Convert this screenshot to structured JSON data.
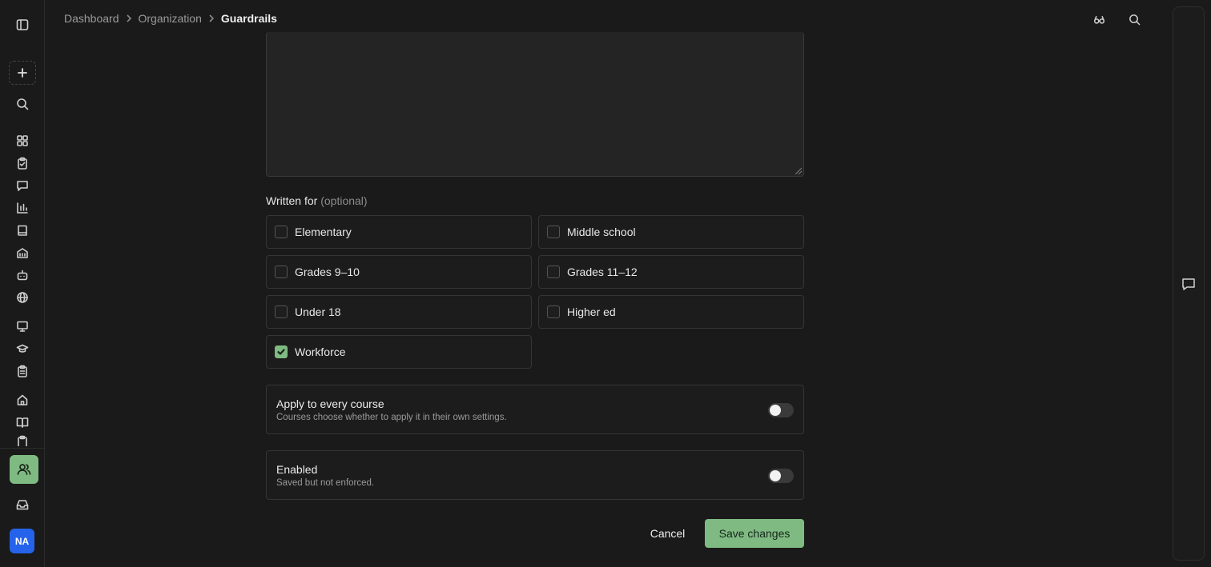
{
  "breadcrumb": {
    "items": [
      "Dashboard",
      "Organization",
      "Guardrails"
    ]
  },
  "form": {
    "written_for_label": "Written for",
    "written_for_optional": "(optional)",
    "audiences": [
      {
        "label": "Elementary",
        "checked": false
      },
      {
        "label": "Middle school",
        "checked": false
      },
      {
        "label": "Grades 9–10",
        "checked": false
      },
      {
        "label": "Grades 11–12",
        "checked": false
      },
      {
        "label": "Under 18",
        "checked": false
      },
      {
        "label": "Higher ed",
        "checked": false
      },
      {
        "label": "Workforce",
        "checked": true
      }
    ],
    "apply_all": {
      "title": "Apply to every course",
      "description": "Courses choose whether to apply it in their own settings.",
      "on": false
    },
    "enabled": {
      "title": "Enabled",
      "description": "Saved but not enforced.",
      "on": false
    }
  },
  "actions": {
    "cancel_label": "Cancel",
    "save_label": "Save changes"
  },
  "user": {
    "initials": "NA"
  },
  "colors": {
    "accent": "#7fba82",
    "avatar": "#2563eb",
    "background": "#1a1a1a"
  },
  "icons": {
    "rail": [
      "sidebar-toggle-icon",
      "plus-icon",
      "search-icon",
      "grid-icon",
      "clipboard-check-icon",
      "chat-icon",
      "bar-chart-icon",
      "book-icon",
      "building-icon",
      "bot-icon",
      "globe-icon",
      "presentation-icon",
      "graduation-cap-icon",
      "clipboard-list-icon",
      "home-icon",
      "open-book-icon",
      "clipboard-icon",
      "users-icon",
      "inbox-icon"
    ],
    "header": [
      "glasses-icon",
      "search-icon"
    ]
  }
}
